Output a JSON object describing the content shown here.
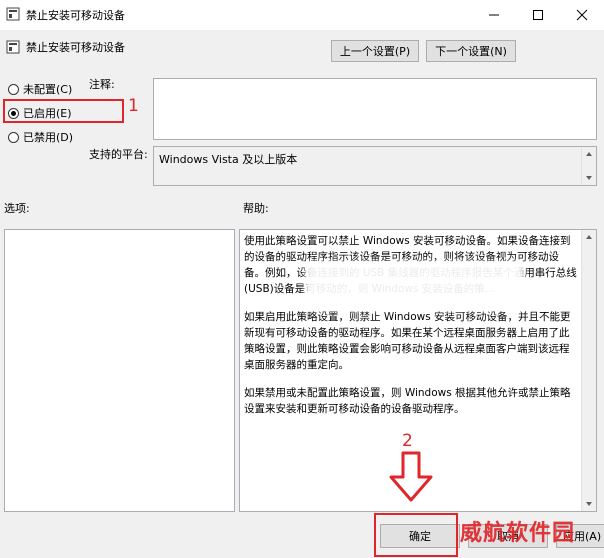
{
  "window": {
    "title": "禁止安装可移动设备"
  },
  "header": {
    "policy_name": "禁止安装可移动设备",
    "prev_label": "上一个设置(P)",
    "next_label": "下一个设置(N)"
  },
  "state": {
    "options": [
      {
        "label": "未配置(C)",
        "checked": false
      },
      {
        "label": "已启用(E)",
        "checked": true
      },
      {
        "label": "已禁用(D)",
        "checked": false
      }
    ]
  },
  "fields": {
    "comment_label": "注释:",
    "comment_value": "",
    "platform_label": "支持的平台:",
    "platform_value": "Windows Vista 及以上版本"
  },
  "panes": {
    "options_label": "选项:",
    "help_label": "帮助:",
    "help_paragraphs": [
      "使用此策略设置可以禁止 Windows 安装可移动设备。如果设备连接到的设备的驱动程序指示该设备是可移动的，则将该设备视为可移动设备。例如，设备连接到的 USB 集线器的驱动程序报告某个通用串行总线(USB)设备是可移动的，则 Windows 安装设备的策...",
      "如果启用此策略设置，则禁止 Windows 安装可移动设备，并且不能更新现有可移动设备的驱动程序。如果在某个远程桌面服务器上启用了此策略设置，则此策略设置会影响可移动设备从远程桌面客户端到该远程桌面服务器的重定向。",
      "如果禁用或未配置此策略设置，则 Windows 根据其他允许或禁止策略设置来安装和更新可移动设备的设备驱动程序。"
    ]
  },
  "footer": {
    "ok_label": "确定",
    "cancel_label": "取消",
    "apply_label": "应用(A)"
  },
  "annotations": {
    "step1": "1",
    "step2": "2"
  },
  "watermark": "威航软件园",
  "colors": {
    "annotation": "#e0262a",
    "background": "#f0f0f0"
  }
}
